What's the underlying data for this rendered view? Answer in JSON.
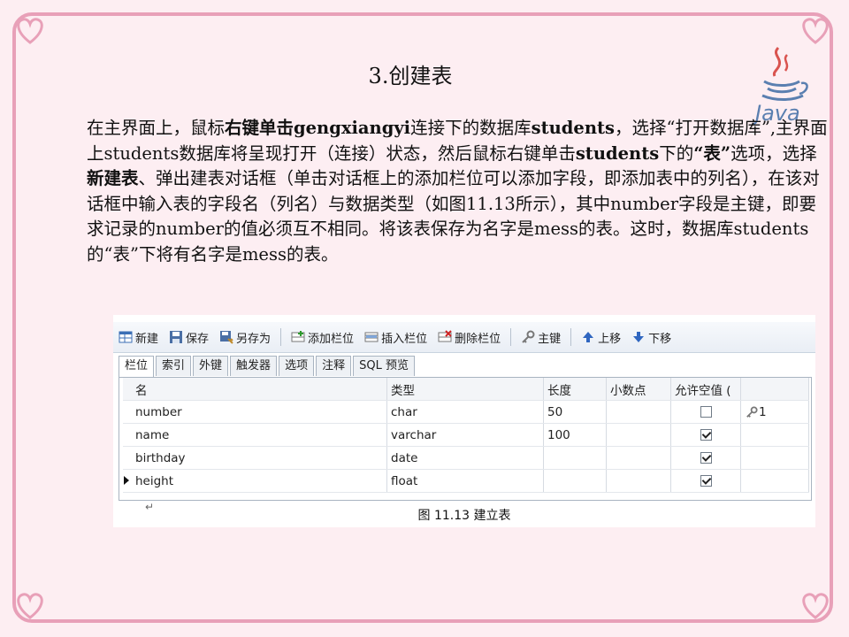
{
  "slide": {
    "title": "3.创建表",
    "logo_text": "Java",
    "paragraph": [
      {
        "text": "在主界面上，鼠标",
        "bold": false
      },
      {
        "text": "右键单击gengxiangyi",
        "bold": true
      },
      {
        "text": "连接下的数据库",
        "bold": false
      },
      {
        "text": "students",
        "bold": true
      },
      {
        "text": "，选择“打开数据库”,主界面上students数据库将呈现打开（连接）状态，然后鼠标右键单击",
        "bold": false
      },
      {
        "text": "students",
        "bold": true
      },
      {
        "text": "下的",
        "bold": false
      },
      {
        "text": "“表”",
        "bold": true
      },
      {
        "text": "选项，选择",
        "bold": false
      },
      {
        "text": "新建表",
        "bold": true
      },
      {
        "text": "、弹出建表对话框（单击对话框上的添加栏位可以添加字段，即添加表中的列名），在该对话框中输入表的字段名（列名）与数据类型（如图11.13所示），其中number字段是主键，即要求记录的number的值必须互不相同。将该表保存为名字是mess的表。这时，数据库students的“表”下将有名字是mess的表。",
        "bold": false
      }
    ]
  },
  "toolbar": {
    "new_label": "新建",
    "save_label": "保存",
    "save_as_label": "另存为",
    "add_field_label": "添加栏位",
    "insert_field_label": "插入栏位",
    "delete_field_label": "删除栏位",
    "primary_key_label": "主键",
    "move_up_label": "上移",
    "move_down_label": "下移"
  },
  "tabs": [
    "栏位",
    "索引",
    "外键",
    "触发器",
    "选项",
    "注释",
    "SQL 预览"
  ],
  "table": {
    "headers": [
      "名",
      "类型",
      "长度",
      "小数点",
      "允许空值 ("
    ],
    "rows": [
      {
        "name": "number",
        "type": "char",
        "length": "50",
        "decimals": "",
        "nullable": false,
        "key": "1"
      },
      {
        "name": "name",
        "type": "varchar",
        "length": "100",
        "decimals": "",
        "nullable": true,
        "key": ""
      },
      {
        "name": "birthday",
        "type": "date",
        "length": "",
        "decimals": "",
        "nullable": true,
        "key": ""
      },
      {
        "name": "height",
        "type": "float",
        "length": "",
        "decimals": "",
        "nullable": true,
        "key": ""
      }
    ]
  },
  "figure": {
    "caption": "图 11.13   建立表",
    "return_mark": "↵"
  },
  "colors": {
    "background": "#fdeef2",
    "border": "#e8a0b8",
    "java_blue": "#5a7fb0",
    "java_red": "#d9534f"
  }
}
